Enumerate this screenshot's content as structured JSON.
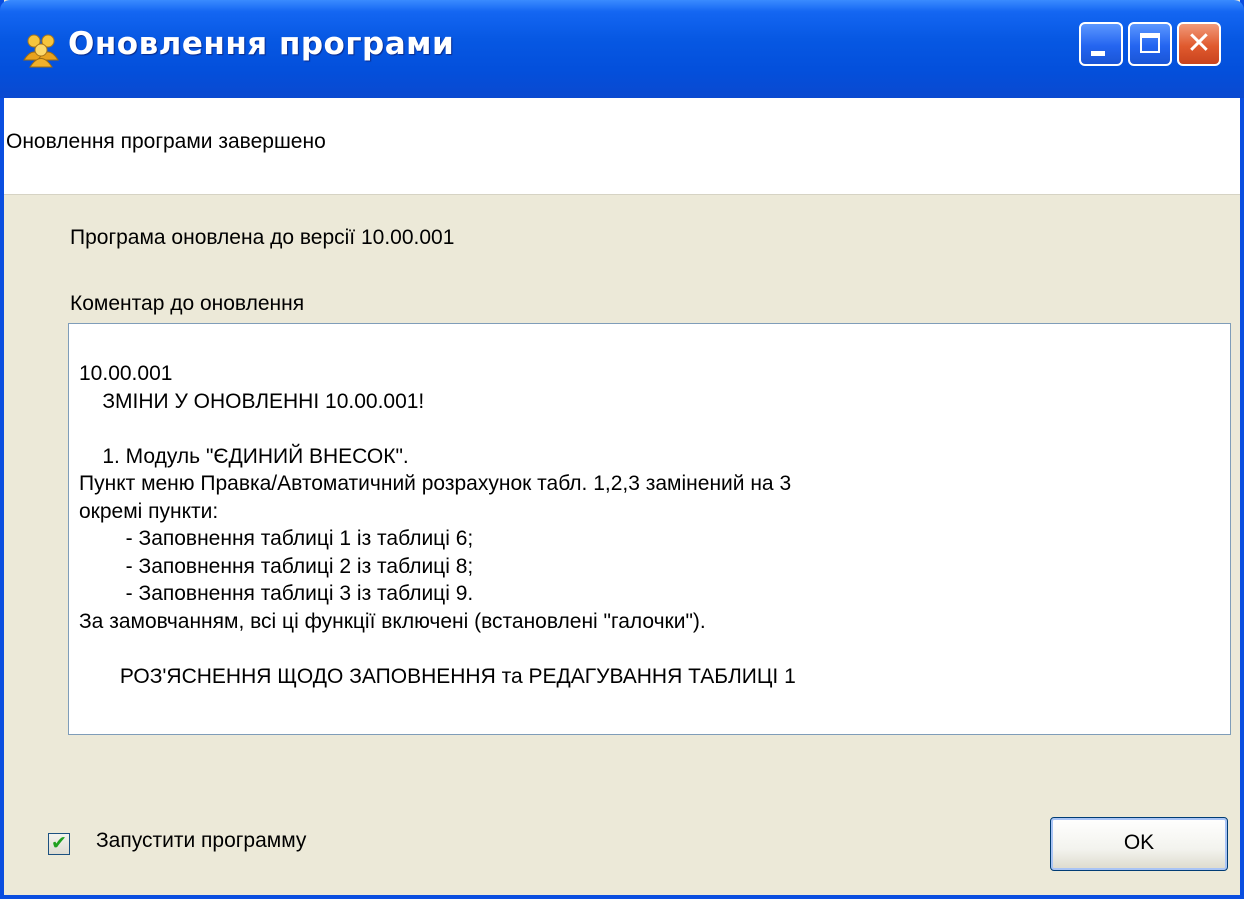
{
  "window": {
    "title": "Оновлення програми",
    "icon": "people-app-icon",
    "controls": {
      "minimize": "minimize-icon",
      "maximize": "maximize-icon",
      "close": "close-icon"
    }
  },
  "header": {
    "message": "Оновлення програми завершено"
  },
  "body": {
    "version_text": "Програма оновлена до версії 10.00.001",
    "comment_label": "Коментар до оновлення",
    "comment_lines": [
      "10.00.001",
      "    ЗМІНИ У ОНОВЛЕННІ 10.00.001!",
      "",
      "    1. Модуль \"ЄДИНИЙ ВНЕСОК\".",
      "Пункт меню Правка/Автоматичний розрахунок табл. 1,2,3 замінений на 3",
      "окремі пункти:",
      "        - Заповнення таблиці 1 із таблиці 6;",
      "        - Заповнення таблиці 2 із таблиці 8;",
      "        - Заповнення таблиці 3 із таблиці 9.",
      "За замовчанням, всі ці функції включені (встановлені \"галочки\").",
      "",
      "       РОЗ'ЯСНЕННЯ ЩОДО ЗАПОВНЕННЯ та РЕДАГУВАННЯ ТАБЛИЦІ 1"
    ]
  },
  "footer": {
    "launch_checkbox_label": "Запустити программу",
    "launch_checked": true,
    "ok_label": "OK"
  },
  "colors": {
    "titlebar": "#0350dc",
    "dialog_bg": "#ece9d8",
    "checkmark": "#21a121",
    "close_button": "#e05a2e"
  }
}
